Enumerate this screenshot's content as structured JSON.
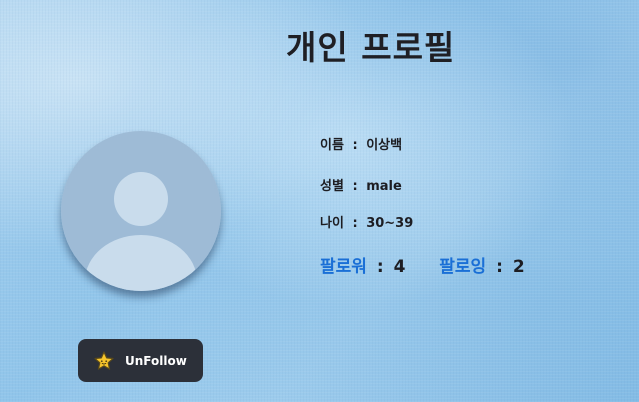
{
  "page": {
    "title": "개인 프로필"
  },
  "profile": {
    "name_label": "이름",
    "name_value": "이상백",
    "gender_label": "성별",
    "gender_value": "male",
    "age_label": "나이",
    "age_value": "30~39",
    "followers_label": "팔로워",
    "followers_value": "4",
    "following_label": "팔로잉",
    "following_value": "2",
    "separator": ":"
  },
  "actions": {
    "unfollow_label": "UnFollow",
    "unfollow_icon": "star-icon"
  },
  "colors": {
    "accent": "#1a6fd6",
    "button_bg": "#2c3039",
    "avatar_bg": "#9ebbd6",
    "avatar_figure": "#c9dcec"
  }
}
